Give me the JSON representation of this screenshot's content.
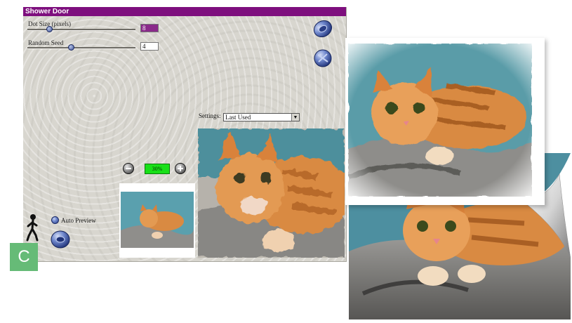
{
  "dialog": {
    "title": "Shower Door",
    "controls": [
      {
        "label": "Dot Size (pixels)",
        "value": "8",
        "slider_fraction": 0.2
      },
      {
        "label": "Random Seed",
        "value": "4",
        "slider_fraction": 0.4
      }
    ],
    "settings": {
      "label": "Settings:",
      "selected": "Last Used"
    },
    "zoom": "30%",
    "auto_preview_label": "Auto Preview"
  },
  "badge": "C",
  "icons": {
    "ok_button": "ok-dial-icon",
    "cancel_button": "cancel-dial-icon",
    "zoom_out": "zoom-out-icon",
    "zoom_in": "zoom-in-icon",
    "walker": "walking-figure-icon",
    "auto_preview_toggle": "toggle-icon",
    "help": "help-disc-icon"
  },
  "colors": {
    "title_bar": "#7e0f7e",
    "dialog_bg": "#d8d6cf",
    "zoom_readout": "#18e018",
    "badge": "#66bb77",
    "knob": "#3a4f96"
  }
}
